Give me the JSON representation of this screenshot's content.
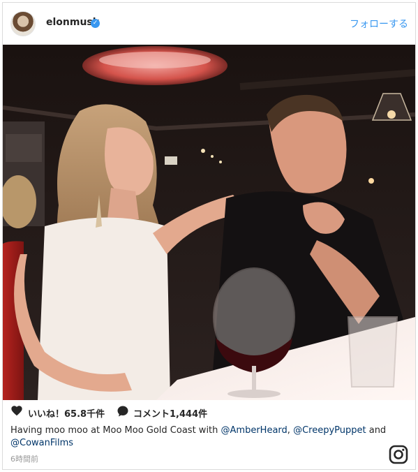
{
  "header": {
    "username": "elonmusk",
    "verified_mark": "✓",
    "follow_label": "フォローする"
  },
  "photo": {
    "description_icon": "photo"
  },
  "actions": {
    "likes_label": "いいね！65.8千件",
    "comments_label": "コメント1,444件",
    "heart_icon": "heart-icon",
    "comment_icon": "comment-icon"
  },
  "caption": {
    "text_1": "Having moo moo at Moo Moo Gold Coast with ",
    "mention_1": "@AmberHeard",
    "text_2": ", ",
    "mention_2": "@CreepyPuppet",
    "text_3": " and ",
    "mention_3": "@CowanFilms"
  },
  "timestamp": "6時間前",
  "colors": {
    "accent": "#3897f0",
    "text": "#262626",
    "muted": "#999999",
    "mention": "#003569"
  }
}
